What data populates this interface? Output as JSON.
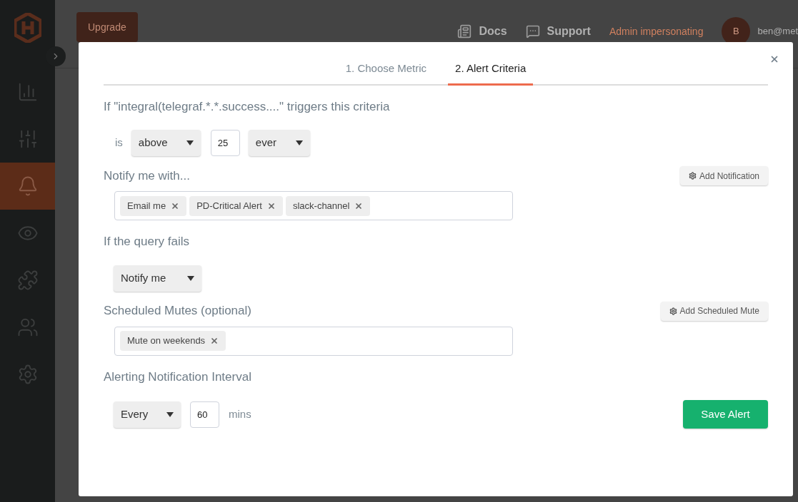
{
  "header": {
    "upgrade": "Upgrade",
    "docs": "Docs",
    "support": "Support",
    "admin": "Admin impersonating",
    "avatar": "B",
    "user": "ben@met"
  },
  "sidebar": {
    "items": [
      {
        "kind": "chart",
        "selected": false
      },
      {
        "kind": "sliders",
        "selected": false
      },
      {
        "kind": "bell",
        "selected": true
      },
      {
        "kind": "eye",
        "selected": false
      },
      {
        "kind": "puzzle",
        "selected": false
      },
      {
        "kind": "users",
        "selected": false
      },
      {
        "kind": "settings",
        "selected": false
      }
    ]
  },
  "modal": {
    "tabs": [
      {
        "label": "1. Choose Metric",
        "selected": false
      },
      {
        "label": "2. Alert Criteria",
        "selected": true
      }
    ],
    "criteria": {
      "heading": "If \"integral(telegraf.*.*.success....\" triggers this criteria",
      "is_label": "is",
      "comparison": "above",
      "threshold": "25",
      "duration": "ever"
    },
    "notify": {
      "heading": "Notify me with...",
      "button": "Add Notification",
      "tags": [
        "Email me",
        "PD-Critical Alert",
        "slack-channel"
      ]
    },
    "query_fails": {
      "heading": "If the query fails",
      "value": "Notify me"
    },
    "mutes": {
      "heading": "Scheduled Mutes (optional)",
      "button": "Add Scheduled Mute",
      "tags": [
        "Mute on weekends"
      ]
    },
    "interval": {
      "heading": "Alerting Notification Interval",
      "mode": "Every",
      "value": "60",
      "unit": "mins"
    },
    "save": "Save Alert"
  }
}
